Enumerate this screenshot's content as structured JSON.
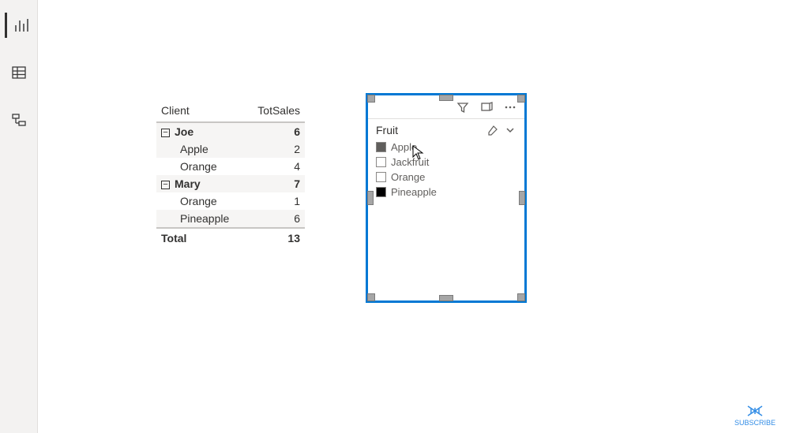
{
  "view_switcher": {
    "report_icon": "report-view",
    "data_icon": "data-view",
    "model_icon": "model-view"
  },
  "matrix": {
    "columns": [
      "Client",
      "TotSales"
    ],
    "groups": [
      {
        "name": "Joe",
        "subtotal": 6,
        "rows": [
          {
            "label": "Apple",
            "value": 2
          },
          {
            "label": "Orange",
            "value": 4
          }
        ]
      },
      {
        "name": "Mary",
        "subtotal": 7,
        "rows": [
          {
            "label": "Orange",
            "value": 1
          },
          {
            "label": "Pineapple",
            "value": 6
          }
        ]
      }
    ],
    "total_label": "Total",
    "total_value": 13
  },
  "slicer": {
    "title": "Fruit",
    "items": [
      {
        "label": "Apple",
        "state": "semi"
      },
      {
        "label": "Jackfruit",
        "state": "unchecked"
      },
      {
        "label": "Orange",
        "state": "unchecked"
      },
      {
        "label": "Pineapple",
        "state": "checked"
      }
    ]
  },
  "subscribe_label": "SUBSCRIBE",
  "colors": {
    "selection": "#0078d4"
  }
}
